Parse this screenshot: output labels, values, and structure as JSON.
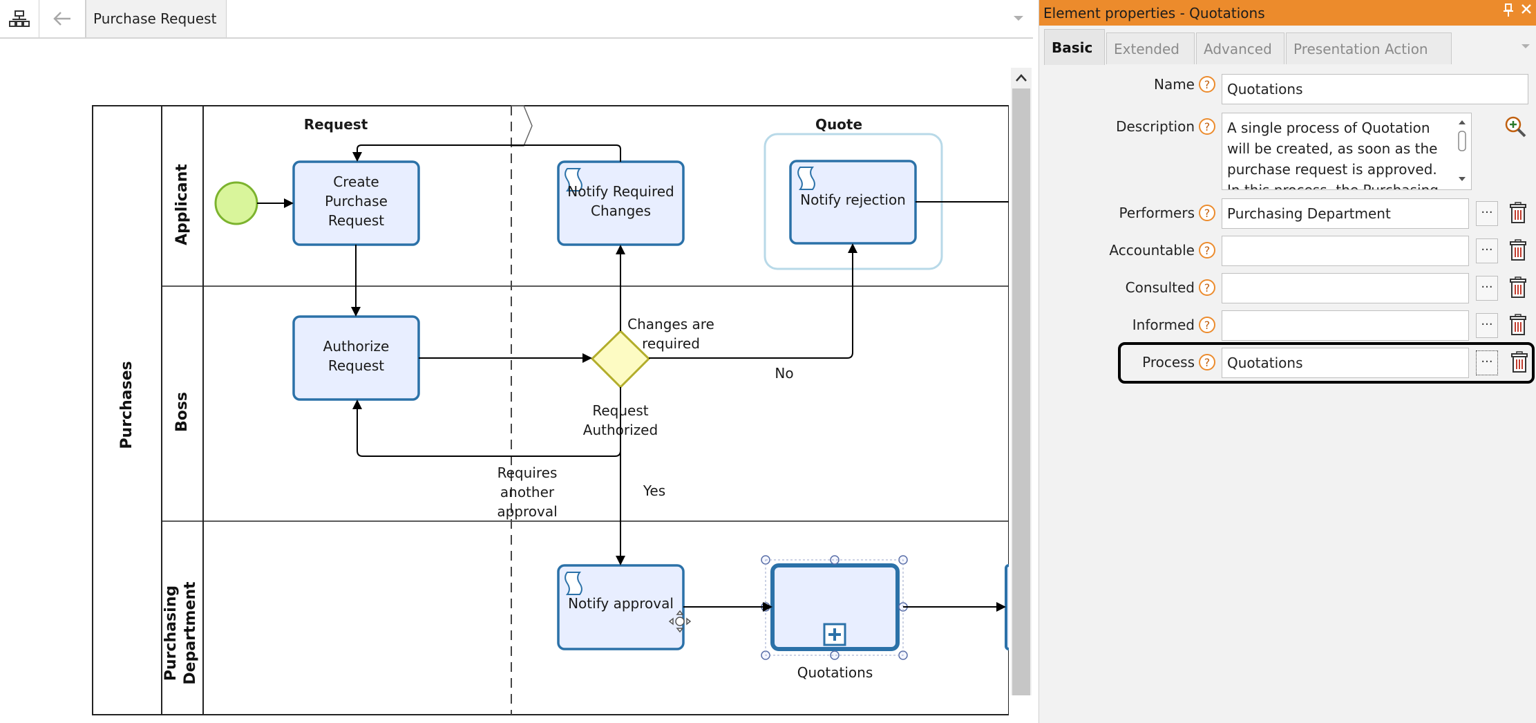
{
  "toolbar": {
    "doc_tab_label": "Purchase Request",
    "icons": [
      "diagram-icon",
      "back-arrow-icon",
      "chevron-down-icon"
    ]
  },
  "diagram": {
    "pool_label": "Purchases",
    "lanes": [
      "Applicant",
      "Boss",
      "Purchasing Department"
    ],
    "milestones": [
      "Request",
      "Quote"
    ],
    "start_event": "",
    "tasks": {
      "create_purchase_request": "Create Purchase Request",
      "notify_required_changes": "Notify Required Changes",
      "notify_rejection": "Notify rejection",
      "authorize_request": "Authorize Request",
      "notify_approval": "Notify approval",
      "quotations": "Quotations"
    },
    "flow_labels": {
      "changes_required": "Changes are required",
      "no": "No",
      "request_authorized": "Request Authorized",
      "requires_another_approval": "Requires another approval",
      "yes": "Yes"
    },
    "colors": {
      "task_fill": "#e8eeff",
      "task_border": "#2b71a8",
      "start_event_fill": "#d9f59b",
      "gateway_fill": "#fdfbc3"
    }
  },
  "panel": {
    "title": "Element properties - Quotations",
    "tabs": [
      "Basic",
      "Extended",
      "Advanced",
      "Presentation Action"
    ],
    "active_tab": "Basic",
    "fields": {
      "name_label": "Name",
      "name_value": "Quotations",
      "description_label": "Description",
      "description_value": "A single process of Quotation will be created, as soon as the purchase request is approved. In this process, the Purchasing",
      "performers_label": "Performers",
      "performers_value": "Purchasing Department",
      "accountable_label": "Accountable",
      "accountable_value": "",
      "consulted_label": "Consulted",
      "consulted_value": "",
      "informed_label": "Informed",
      "informed_value": "",
      "process_label": "Process",
      "process_value": "Quotations"
    },
    "ellipsis": "...",
    "help_glyph": "?",
    "colors": {
      "title_bar": "#ec8b2c"
    }
  }
}
